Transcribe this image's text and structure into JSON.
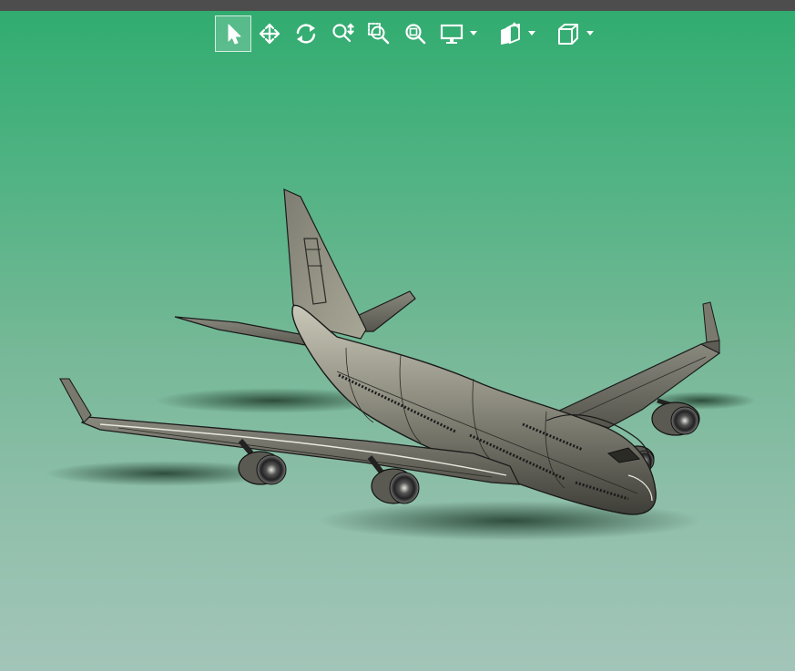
{
  "window": {
    "title_bar_color": "#4d4d4d"
  },
  "viewport": {
    "background_top": "#31ac70",
    "background_bottom": "#a3c5b9",
    "model": "airplane-model"
  },
  "toolbar": {
    "icon_color": "#ffffff",
    "tools": [
      {
        "name": "select-tool",
        "icon": "cursor-arrow-icon",
        "active": true
      },
      {
        "name": "pan-tool",
        "icon": "move-arrows-icon",
        "active": false
      },
      {
        "name": "rotate-tool",
        "icon": "rotate-icon",
        "active": false
      },
      {
        "name": "zoom-tool",
        "icon": "zoom-updown-icon",
        "active": false
      },
      {
        "name": "zoom-window-tool",
        "icon": "zoom-window-icon",
        "active": false
      },
      {
        "name": "zoom-fit-tool",
        "icon": "zoom-fit-icon",
        "active": false
      }
    ],
    "dropdowns": [
      {
        "name": "display-style",
        "icon": "monitor-icon"
      },
      {
        "name": "section-view",
        "icon": "section-view-icon"
      },
      {
        "name": "view-orientation",
        "icon": "cube-icon"
      }
    ]
  }
}
